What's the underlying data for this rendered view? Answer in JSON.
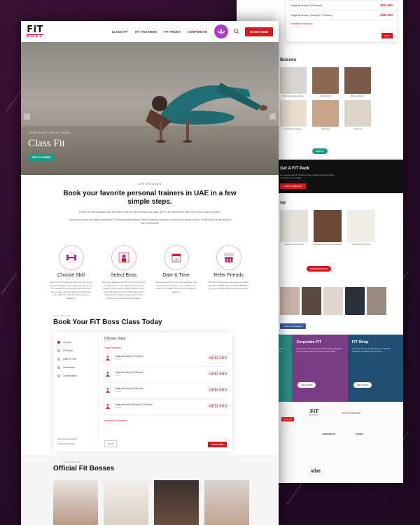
{
  "front": {
    "logo": {
      "fit": "FiT",
      "boss": "BOSS"
    },
    "nav": {
      "items": [
        "CLASS FIT",
        "FIT TRAINERS",
        "FIT PACKS",
        "CORPORATE"
      ],
      "book_now": "BOOK NOW"
    },
    "hero": {
      "label": "DISCOVER YOUR FIT BOSS",
      "title": "Class Fit",
      "button": "SEE CLASSES"
    },
    "intro": {
      "kicker": "LIFE EVOLVED",
      "heading": "Book your favorite personal trainers in UAE in a few simple steps.",
      "p1": "Its time for new resolutions and we made it easy for you to develop new skills, get FiT, and become the best YOU in mind, body, and spirit.",
      "p2": "Choose from across our range of awesome FiT Boss personal trainers, select a date that works for you and let us handle the rest. We'll be with you all along the way. Get Excited!"
    },
    "steps": [
      {
        "title": "Choose Skill",
        "text": "Select your FiT Class or Skill, and one of your sessions. Whether your looking for one to one PT classes OR with family and friends, we have a wide range of classes that will bring you skills, fun, and an achievement to transform!"
      },
      {
        "title": "Select Boss",
        "text": "Boss your skills and get FiT through our range of curated one to one classes across Yoga, Pilates, Dance, Sports, Boxing and so much more. We have the best trainers around to bring you the highest quality training that brings you enhanced skill and fitness."
      },
      {
        "title": "Date & Time",
        "text": "Lets set a date! Pick your date and time, and we will bring the class to you - whether at home, on a beach, or at one of our partner locations."
      },
      {
        "title": "Refer Friends",
        "text": "Winning is best when everyone does. Refer and GET 40AED OFF, and GIVE 40AED to your friend when booking their next class."
      }
    ],
    "booking": {
      "crumb": "Home  ·  Book Now",
      "heading": "Book Your FiT Boss Class Today",
      "side_items": [
        "Choose",
        "FiT Boss",
        "Date & Time",
        "Information",
        "Confirmation"
      ],
      "questions": "Have any questions?",
      "phone": "+971 50 000 0000",
      "title": "Choose class",
      "section1": "Yoga Sessions",
      "rows": [
        {
          "name": "Yoga all levels (1 Person)",
          "sub": "1h 0min",
          "price": "AED 250"
        },
        {
          "name": "Yoga all levels (2 Person)",
          "sub": "1h 0min",
          "price": "AED 450"
        },
        {
          "name": "Yoga all levels (3 Person)",
          "sub": "1h 0min",
          "price": "AED 600"
        },
        {
          "name": "Yoga all levels (Group 5+ Person)",
          "sub": "1h 0min",
          "price": "AED 900"
        }
      ],
      "section2": "Meditation Sessions",
      "back": "BACK",
      "next": "NEXT STEP"
    },
    "bosses": {
      "kicker": "Our FiT Boss Team",
      "heading": "Official Fit Bosses"
    }
  },
  "back": {
    "cart_rows": [
      {
        "name": "Yoga all levels (3 Person)",
        "price": "AED 600"
      },
      {
        "name": "Yoga all levels (Group 5+ Person)",
        "price": "AED 900"
      }
    ],
    "cart_section": "Meditation Sessions",
    "cart_next": "NEXT",
    "bosses_heading": "Bosses",
    "boss_names_row1": [
      "Gianna Sound Healing",
      "Stefan Mills",
      "Ellen Holbrook"
    ],
    "boss_names_row2": [
      "Aya Ahmar Sisters",
      "Michaela",
      "Chris Ali"
    ],
    "see_all": "SEE ALL",
    "pack": {
      "title": "Get A FiT Pack",
      "text": "Get started with FiT Packs to give yourself a goal and stay motivated in new ways.",
      "button": "CHECK THEM OUT"
    },
    "shop_heading": "op",
    "products": [
      "Garden Swing Stool",
      "Wooden Coconut Sound Bowl",
      "Your Pure Fit Power"
    ],
    "view_products": "VIEW PRODUCTS",
    "insta_btn": "Follow on Instagram",
    "panels": [
      {
        "title": "FiT Transform",
        "text": "Physical, Mental and Spiritual health. Create a holistic journey that transforms how you live.",
        "button": "SEE MORE",
        "color": "#2a8f83"
      },
      {
        "title": "Corporate FiT",
        "text": "Corporate FiT is an all-rounded wellness program for your team. Bring the best to your office.",
        "button": "SEE MORE",
        "color": "#7b3c86"
      },
      {
        "title": "FiT Shop",
        "text": "Our shop brings you the finest in wellness products to elevate your journey.",
        "button": "SEE MORE",
        "color": "#1f4f73"
      }
    ],
    "footer": {
      "logo_fit": "FiT",
      "logo_boss": "BOSS",
      "cols": [
        "CORPORATE",
        "OTHER"
      ],
      "stay": "STAY CONNECTED",
      "signup": "SIGN UP",
      "brand": "vibe"
    }
  },
  "colors": {
    "accent": "#d71920",
    "teal": "#1b9a8a",
    "purple": "#a93fc7"
  }
}
